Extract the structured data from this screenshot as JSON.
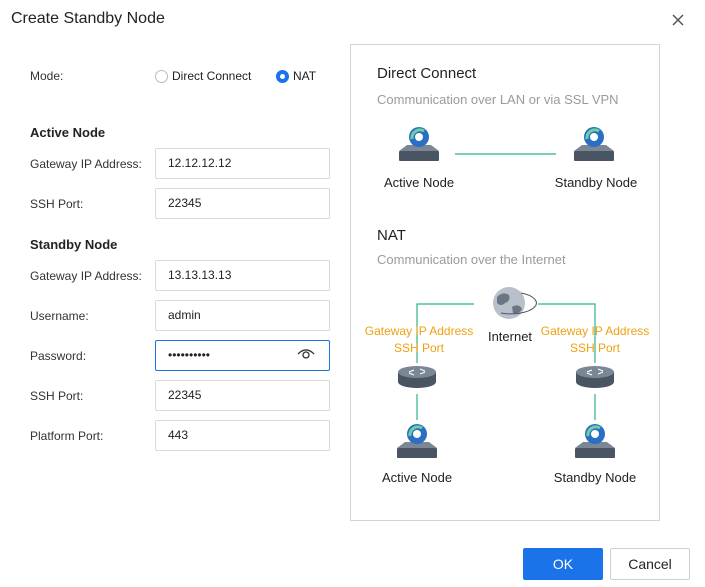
{
  "dialog": {
    "title": "Create Standby Node"
  },
  "mode": {
    "label": "Mode:",
    "options": [
      "Direct Connect",
      "NAT"
    ],
    "selected": "NAT"
  },
  "active_node": {
    "heading": "Active Node",
    "gateway_label": "Gateway IP Address:",
    "gateway_value": "12.12.12.12",
    "ssh_label": "SSH Port:",
    "ssh_value": "22345"
  },
  "standby_node": {
    "heading": "Standby Node",
    "gateway_label": "Gateway IP Address:",
    "gateway_value": "13.13.13.13",
    "username_label": "Username:",
    "username_value": "admin",
    "password_label": "Password:",
    "password_value": "••••••••••",
    "ssh_label": "SSH Port:",
    "ssh_value": "22345",
    "platform_label": "Platform Port:",
    "platform_value": "443"
  },
  "diagram": {
    "direct": {
      "title": "Direct Connect",
      "subtitle": "Communication over LAN or via SSL VPN",
      "left_node": "Active Node",
      "right_node": "Standby Node"
    },
    "nat": {
      "title": "NAT",
      "subtitle": "Communication over the Internet",
      "internet": "Internet",
      "left_line1": "Gateway IP Address",
      "left_line2": "SSH Port",
      "right_line1": "Gateway IP Address",
      "right_line2": "SSH Port",
      "left_node": "Active Node",
      "right_node": "Standby Node"
    }
  },
  "buttons": {
    "ok": "OK",
    "cancel": "Cancel"
  },
  "colors": {
    "accent": "#1a73e8",
    "highlight": "#f0a010",
    "link_line": "#2fb38a"
  }
}
